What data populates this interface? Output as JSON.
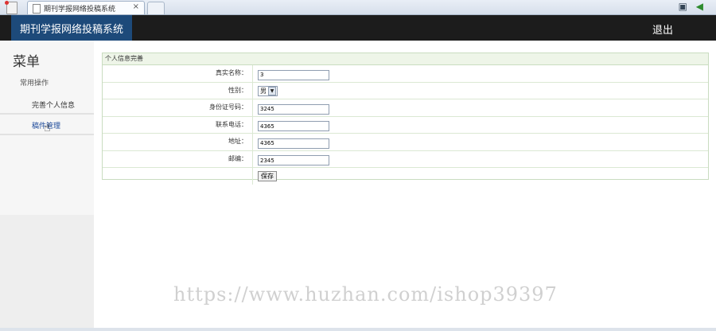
{
  "browser": {
    "tab_title": "期刊学报网络投稿系统",
    "tab_close": "×"
  },
  "header": {
    "brand": "期刊学报网络投稿系统",
    "logout": "退出"
  },
  "sidebar": {
    "title": "菜单",
    "group": "常用操作",
    "items": [
      {
        "label": "完善个人信息"
      },
      {
        "label": "稿件管理"
      }
    ]
  },
  "panel": {
    "title": "个人信息完善",
    "fields": [
      {
        "label": "真实名称：",
        "value": "3"
      },
      {
        "label": "性别：",
        "value": "男"
      },
      {
        "label": "身份证号码：",
        "value": "3245"
      },
      {
        "label": "联系电话：",
        "value": "4365"
      },
      {
        "label": "地址：",
        "value": "4365"
      },
      {
        "label": "邮编：",
        "value": "2345"
      }
    ],
    "save_label": "保存"
  },
  "watermark": "https://www.huzhan.com/ishop39397"
}
